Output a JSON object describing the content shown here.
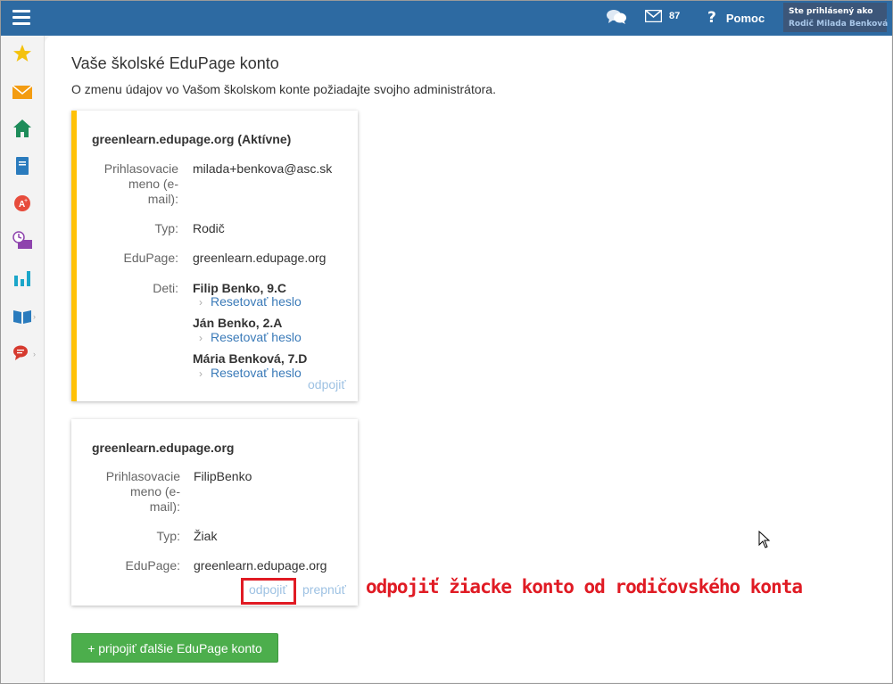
{
  "topbar": {
    "mail_count": "87",
    "help_label": "Pomoc",
    "user_caption": "Ste prihlásený ako",
    "user_name": "Rodič Milada Benková"
  },
  "sidebar": {
    "items": [
      {
        "icon": "star-icon",
        "color": "#f4c20d"
      },
      {
        "icon": "envelope-icon",
        "color": "#f39c12"
      },
      {
        "icon": "home-icon",
        "color": "#1e8c5a"
      },
      {
        "icon": "notebook-icon",
        "color": "#2a7bbd"
      },
      {
        "icon": "grades-icon",
        "color": "#e74c3c"
      },
      {
        "icon": "attendance-icon",
        "color": "#8e44ad"
      },
      {
        "icon": "stats-icon",
        "color": "#1ba6c9"
      },
      {
        "icon": "book-icon",
        "color": "#2a7bbd"
      },
      {
        "icon": "discussion-icon",
        "color": "#d63a2f"
      }
    ]
  },
  "main": {
    "title": "Vaše školské EduPage konto",
    "subtitle": "O zmenu údajov vo Vašom školskom konte požiadajte svojho administrátora."
  },
  "accounts": [
    {
      "title": "greenlearn.edupage.org (Aktívne)",
      "login_label_lines": [
        "Prihlasovacie",
        "meno (e-",
        "mail):"
      ],
      "login": "milada+benkova@asc.sk",
      "type_label": "Typ:",
      "type": "Rodič",
      "edupage_label": "EduPage:",
      "edupage": "greenlearn.edupage.org",
      "children_label": "Deti:",
      "children": [
        {
          "name": "Filip Benko, 9.C",
          "reset": "Resetovať heslo"
        },
        {
          "name": "Ján Benko, 2.A",
          "reset": "Resetovať heslo"
        },
        {
          "name": "Mária Benková, 7.D",
          "reset": "Resetovať heslo"
        }
      ],
      "disconnect": "odpojiť"
    },
    {
      "title": "greenlearn.edupage.org",
      "login_label_lines": [
        "Prihlasovacie",
        "meno (e-",
        "mail):"
      ],
      "login": "FilipBenko",
      "type_label": "Typ:",
      "type": "Žiak",
      "edupage_label": "EduPage:",
      "edupage": "greenlearn.edupage.org",
      "disconnect": "odpojiť",
      "switch": "prepnúť"
    }
  ],
  "annotation": "odpojiť žiacke konto od rodičovského konta",
  "add_button": "+ pripojiť ďalšie EduPage konto",
  "colors": {
    "topbar": "#2d6aa2",
    "active_border": "#ffc107",
    "link": "#3a7ab8",
    "annotation": "#e01b24",
    "button": "#4cae4c"
  }
}
